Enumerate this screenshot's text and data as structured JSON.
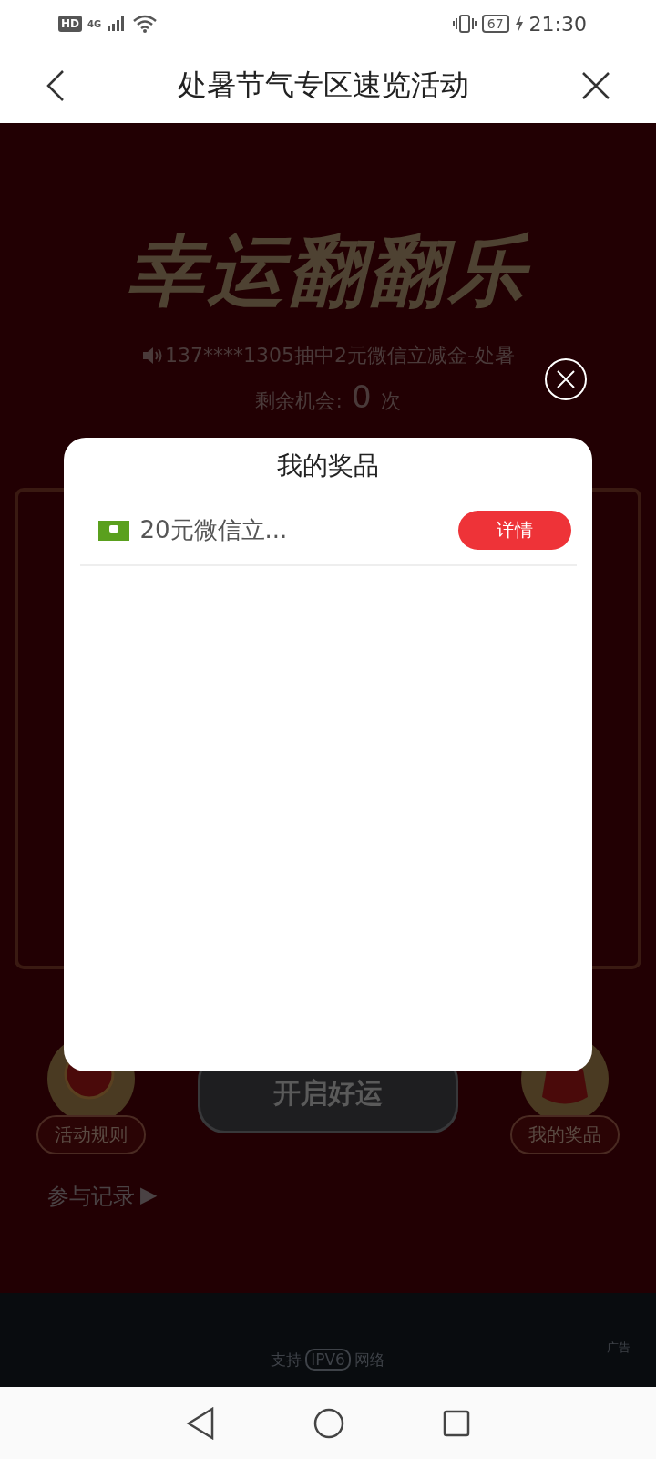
{
  "status_bar": {
    "hd": "HD",
    "network": "4G",
    "battery": "67",
    "time": "21:30"
  },
  "header": {
    "title": "处暑节气专区速览活动"
  },
  "game": {
    "title_art": "幸运翻翻乐",
    "ticker": "137****1305抽中2元微信立减金-处暑",
    "remaining": {
      "label": "剩余机会:",
      "count": "0",
      "unit": "次"
    },
    "side_buttons": [
      {
        "label": "活动规则",
        "kind": "rules"
      },
      {
        "label": "我的奖品",
        "kind": "prizes"
      }
    ],
    "start_button": "开启好运",
    "records": {
      "label": "参与记录",
      "arrow": "▶"
    }
  },
  "modal": {
    "title": "我的奖品",
    "prizes": [
      {
        "name": "20元微信立...",
        "action": "详情"
      }
    ]
  },
  "footer": {
    "support": "支持",
    "badge": "IPV6",
    "network": "网络",
    "ad": "广告"
  }
}
